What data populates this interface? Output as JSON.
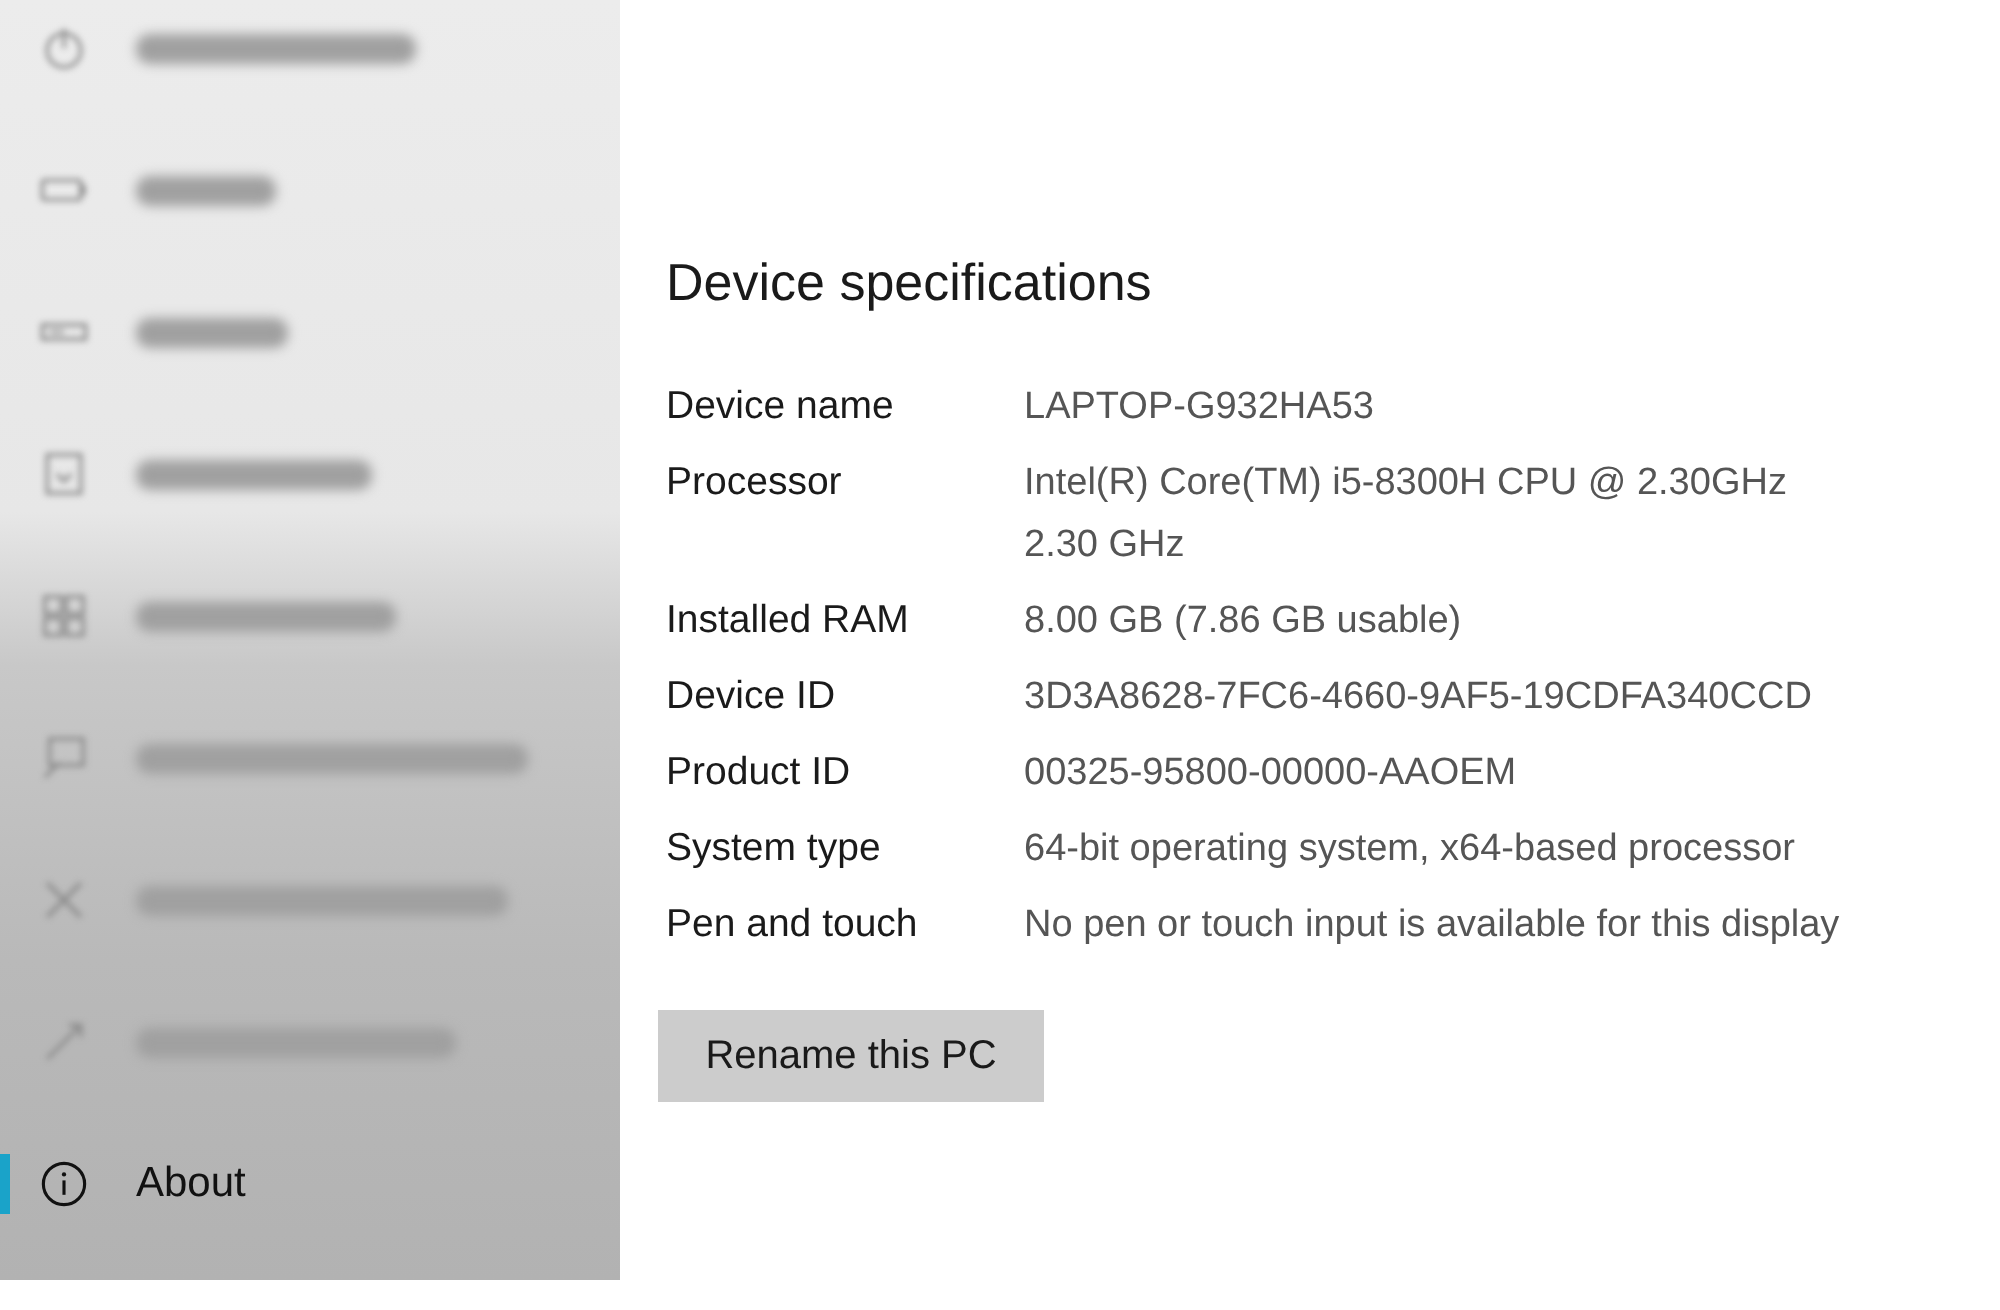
{
  "sidebar": {
    "items": [
      {
        "selected": false,
        "blurred": true
      },
      {
        "selected": false,
        "blurred": true
      },
      {
        "selected": false,
        "blurred": true
      },
      {
        "selected": false,
        "blurred": true
      },
      {
        "selected": false,
        "blurred": true
      },
      {
        "selected": false,
        "blurred": true
      },
      {
        "selected": false,
        "blurred": true
      },
      {
        "selected": false,
        "blurred": true
      },
      {
        "label": "About",
        "selected": true,
        "blurred": false
      }
    ]
  },
  "main": {
    "title": "Device specifications",
    "specs": [
      {
        "label": "Device name",
        "value": "LAPTOP-G932HA53"
      },
      {
        "label": "Processor",
        "value": "Intel(R) Core(TM) i5-8300H CPU @ 2.30GHz\n2.30 GHz"
      },
      {
        "label": "Installed RAM",
        "value": "8.00 GB (7.86 GB usable)"
      },
      {
        "label": "Device ID",
        "value": "3D3A8628-7FC6-4660-9AF5-19CDFA340CCD"
      },
      {
        "label": "Product ID",
        "value": "00325-95800-00000-AAOEM"
      },
      {
        "label": "System type",
        "value": "64-bit operating system, x64-based processor"
      },
      {
        "label": "Pen and touch",
        "value": "No pen or touch input is available for this display"
      }
    ],
    "button": "Rename this PC"
  }
}
